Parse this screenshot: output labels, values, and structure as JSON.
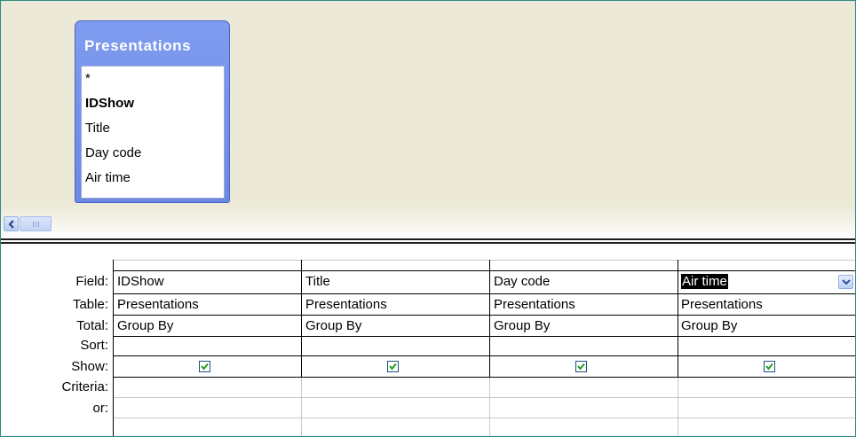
{
  "design_pane": {
    "table": {
      "title": "Presentations",
      "fields": [
        {
          "label": "*",
          "primary_key": false
        },
        {
          "label": "IDShow",
          "primary_key": true
        },
        {
          "label": "Title",
          "primary_key": false
        },
        {
          "label": "Day code",
          "primary_key": false
        },
        {
          "label": "Air time",
          "primary_key": false
        }
      ]
    },
    "scrollbar": {
      "left_icon": "chevron-left-icon",
      "thumb_icon": "grip-icon"
    }
  },
  "grid": {
    "row_labels": {
      "field": "Field:",
      "table": "Table:",
      "total": "Total:",
      "sort": "Sort:",
      "show": "Show:",
      "criteria": "Criteria:",
      "or": "or:"
    },
    "columns": [
      {
        "field": "IDShow",
        "table": "Presentations",
        "total": "Group By",
        "sort": "",
        "show": true,
        "criteria": "",
        "or": ""
      },
      {
        "field": "Title",
        "table": "Presentations",
        "total": "Group By",
        "sort": "",
        "show": true,
        "criteria": "",
        "or": ""
      },
      {
        "field": "Day code",
        "table": "Presentations",
        "total": "Group By",
        "sort": "",
        "show": true,
        "criteria": "",
        "or": ""
      },
      {
        "field": "Air time",
        "table": "Presentations",
        "total": "Group By",
        "sort": "",
        "show": true,
        "criteria": "",
        "or": "",
        "selected": true
      }
    ],
    "dropdown_icon": "chevron-down-icon",
    "checkbox_icon": "checkmark-icon"
  },
  "colors": {
    "table_header": "#7f9cf0",
    "design_bg": "#ece9d8",
    "check_mark": "#21a121",
    "frame_border": "#2e8b83"
  }
}
